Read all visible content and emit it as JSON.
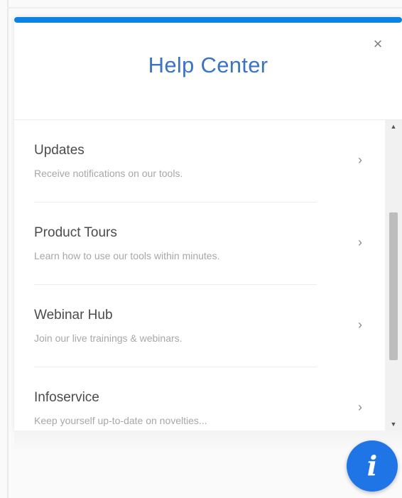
{
  "header": {
    "title": "Help Center",
    "close_icon": "×"
  },
  "items": [
    {
      "title": "Updates",
      "description": "Receive notifications on our tools.",
      "chevron": "›"
    },
    {
      "title": "Product Tours",
      "description": "Learn how to use our tools within minutes.",
      "chevron": "›"
    },
    {
      "title": "Webinar Hub",
      "description": "Join our live trainings & webinars.",
      "chevron": "›"
    },
    {
      "title": "Infoservice",
      "description": "Keep yourself up-to-date on novelties...",
      "chevron": "›"
    }
  ],
  "scrollbar": {
    "up_arrow": "▲",
    "down_arrow": "▼"
  },
  "fab": {
    "icon_text": "i"
  },
  "colors": {
    "accent_bar": "#0a84e3",
    "title": "#3b73c5",
    "fab": "#1f74e6"
  }
}
